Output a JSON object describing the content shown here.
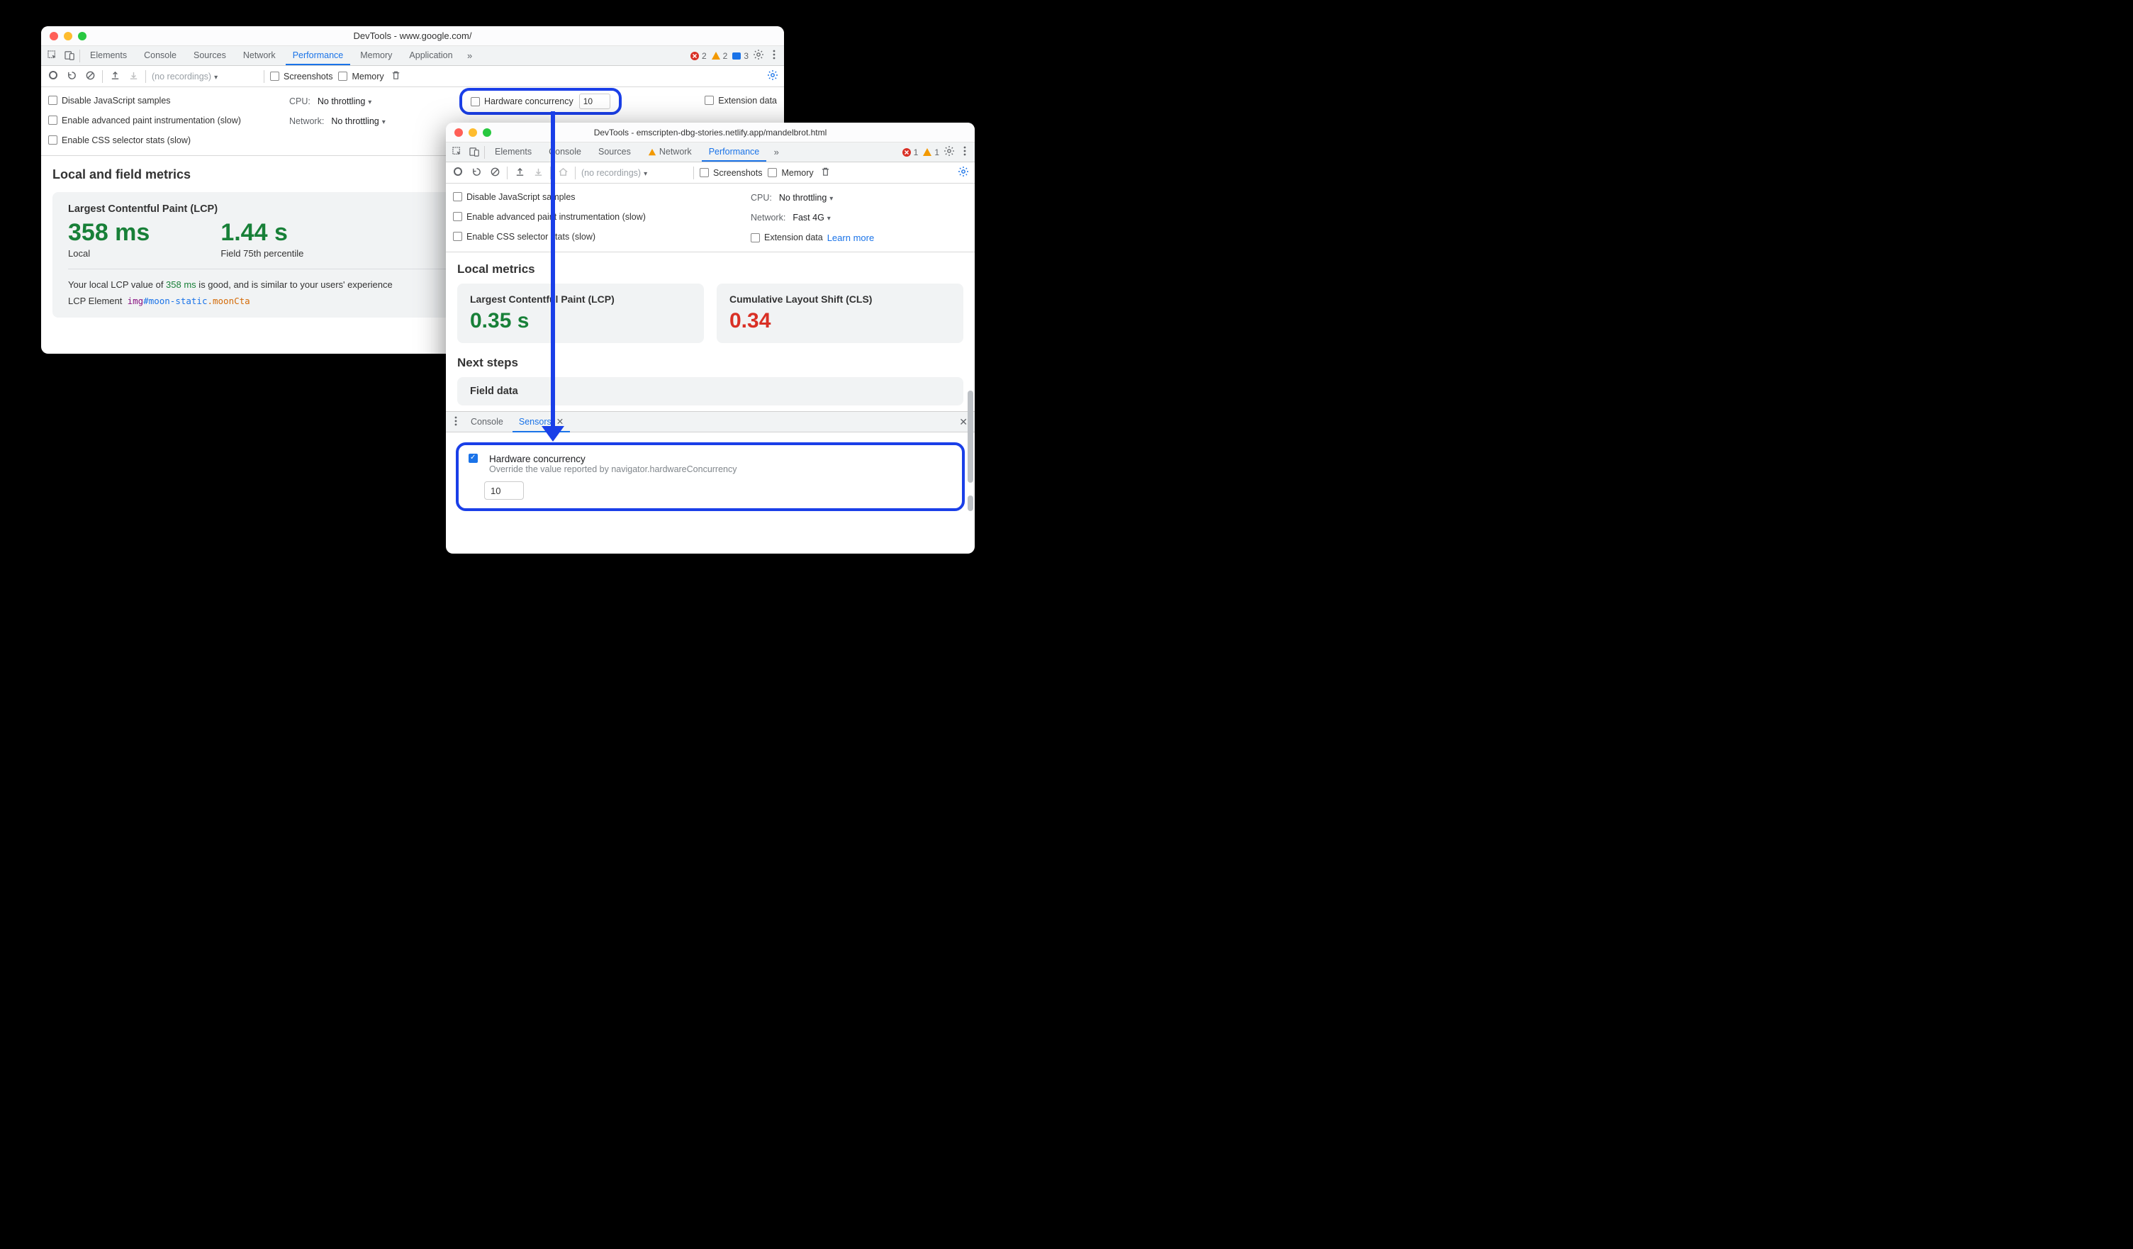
{
  "windowA": {
    "title": "DevTools - www.google.com/",
    "tabs": [
      "Elements",
      "Console",
      "Sources",
      "Network",
      "Performance",
      "Memory",
      "Application"
    ],
    "activeTab": "Performance",
    "issues": {
      "errors": "2",
      "warnings": "2",
      "info": "3"
    },
    "recLabel": "(no recordings)",
    "screenshots": "Screenshots",
    "memory": "Memory",
    "settings": {
      "disableJs": "Disable JavaScript samples",
      "advancedPaint": "Enable advanced paint instrumentation (slow)",
      "cssSelector": "Enable CSS selector stats (slow)",
      "cpuLabel": "CPU:",
      "cpuVal": "No throttling",
      "netLabel": "Network:",
      "netVal": "No throttling",
      "hwConcLabel": "Hardware concurrency",
      "hwConcVal": "10",
      "extData": "Extension data"
    },
    "metrics": {
      "heading": "Local and field metrics",
      "lcpTitle": "Largest Contentful Paint (LCP)",
      "localVal": "358 ms",
      "localSub": "Local",
      "fieldVal": "1.44 s",
      "fieldSub": "Field 75th percentile",
      "descPrefix": "Your local LCP value of ",
      "descMid": "358 ms",
      "descSuffix": " is good, and is similar to your users' experience",
      "elemLabel": "LCP Element",
      "elemTag": "img",
      "elemId": "#moon-static",
      "elemClass": ".moonCta"
    }
  },
  "windowB": {
    "title": "DevTools - emscripten-dbg-stories.netlify.app/mandelbrot.html",
    "tabs": [
      "Elements",
      "Console",
      "Sources",
      "Network",
      "Performance"
    ],
    "warnTab": "Network",
    "activeTab": "Performance",
    "issues": {
      "errors": "1",
      "warnings": "1"
    },
    "recLabel": "(no recordings)",
    "screenshots": "Screenshots",
    "memory": "Memory",
    "settings": {
      "disableJs": "Disable JavaScript samples",
      "advancedPaint": "Enable advanced paint instrumentation (slow)",
      "cssSelector": "Enable CSS selector stats (slow)",
      "cpuLabel": "CPU:",
      "cpuVal": "No throttling",
      "netLabel": "Network:",
      "netVal": "Fast 4G",
      "extData": "Extension data",
      "learnMore": "Learn more"
    },
    "metrics": {
      "heading": "Local metrics",
      "lcpTitle": "Largest Contentful Paint (LCP)",
      "lcpVal": "0.35 s",
      "clsTitle": "Cumulative Layout Shift (CLS)",
      "clsVal": "0.34",
      "nextSteps": "Next steps",
      "fieldData": "Field data"
    },
    "drawer": {
      "tabs": [
        "Console",
        "Sensors"
      ],
      "active": "Sensors"
    },
    "sensor": {
      "title": "Hardware concurrency",
      "sub": "Override the value reported by navigator.hardwareConcurrency",
      "val": "10"
    }
  }
}
